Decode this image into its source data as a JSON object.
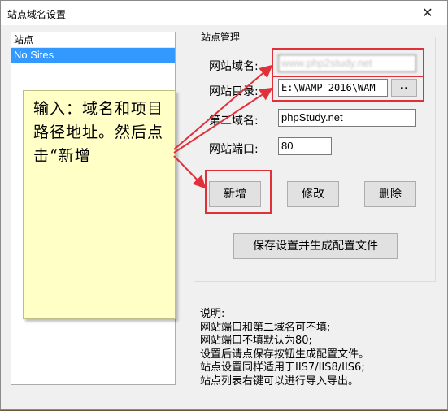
{
  "window": {
    "title": "站点域名设置"
  },
  "site_list": {
    "header": "站点",
    "items": [
      {
        "label": "No Sites"
      }
    ]
  },
  "callout": {
    "text": "输入：域名和项目路径地址。然后点击“新增"
  },
  "group": {
    "title": "站点管理",
    "domain_label": "网站域名:",
    "domain_value": "www.php2study.net",
    "dir_label": "网站目录:",
    "dir_value": "E:\\WAMP 2016\\WAM",
    "browse_label": "..",
    "second_domain_label": "第二域名:",
    "second_domain_value": "phpStudy.net",
    "port_label": "网站端口:",
    "port_value": "80",
    "add_label": "新增",
    "edit_label": "修改",
    "delete_label": "删除",
    "save_label": "保存设置并生成配置文件"
  },
  "notes": [
    "说明:",
    "网站端口和第二域名可不填;",
    "网站端口不填默认为80;",
    "设置后请点保存按钮生成配置文件。",
    "站点设置同样适用于IIS7/IIS8/IIS6;",
    "站点列表右键可以进行导入导出。"
  ],
  "colors": {
    "annotation_red": "#e0303a",
    "selection_blue": "#3399ff",
    "callout_yellow": "#ffffc6"
  }
}
